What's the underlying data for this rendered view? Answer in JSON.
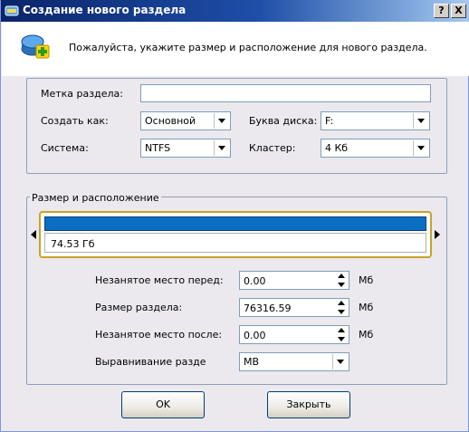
{
  "window": {
    "title": "Создание нового раздела",
    "help_button": "?",
    "close_button": "X"
  },
  "header": {
    "text": "Пожалуйста, укажите размер и расположение для нового раздела."
  },
  "properties": {
    "label_field_label": "Метка раздела:",
    "label_field_value": "",
    "create_as_label": "Создать как:",
    "create_as_value": "Основной",
    "drive_letter_label": "Буква диска:",
    "drive_letter_value": "F:",
    "filesystem_label": "Система:",
    "filesystem_value": "NTFS",
    "cluster_label": "Кластер:",
    "cluster_value": "4 Кб"
  },
  "size_location": {
    "group_title": "Размер и расположение",
    "partition_size_display": "74.53 Гб",
    "free_before_label": "Незанятое место перед:",
    "free_before_value": "0.00",
    "partition_size_label": "Размер раздела:",
    "partition_size_value": "76316.59",
    "free_after_label": "Незанятое место после:",
    "free_after_value": "0.00",
    "alignment_label": "Выравнивание разде",
    "alignment_value": "MB",
    "unit": "Мб"
  },
  "buttons": {
    "ok": "OK",
    "close": "Закрыть"
  },
  "colors": {
    "title_bar": "#0a246a",
    "partition_bar": "#0a6fc2",
    "selection_border": "#c9a227"
  }
}
